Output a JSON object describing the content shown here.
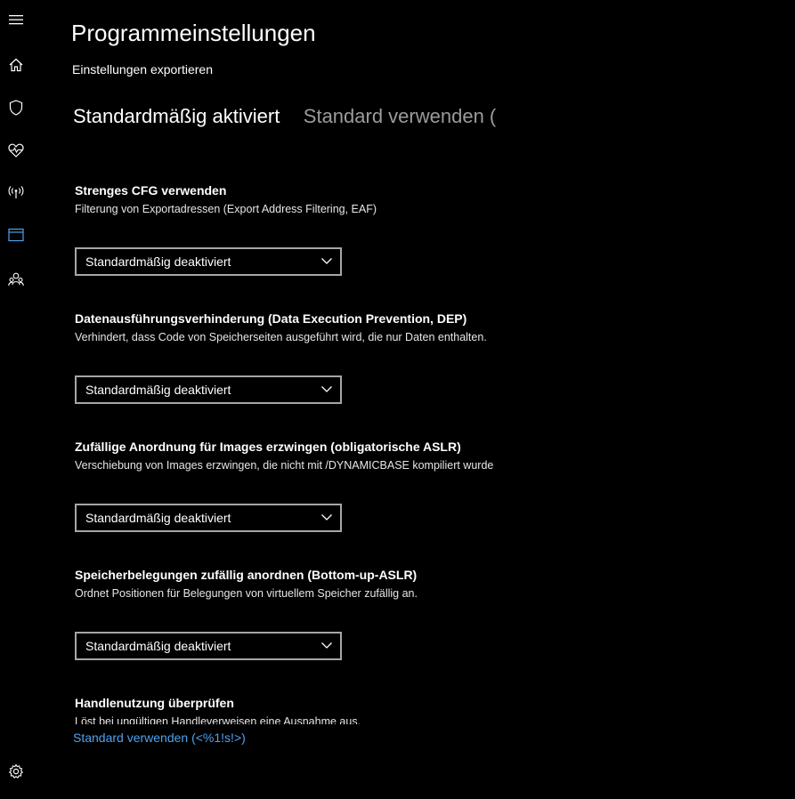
{
  "nav": {
    "items": [
      {
        "icon": "hamburger-menu-icon"
      },
      {
        "icon": "home-icon"
      },
      {
        "icon": "shield-icon"
      },
      {
        "icon": "heart-pulse-icon"
      },
      {
        "icon": "network-antenna-icon"
      },
      {
        "icon": "app-browser-icon",
        "active": true
      },
      {
        "icon": "family-icon"
      }
    ],
    "settings_icon": "gear-icon",
    "accent_color": "#4ea2ef"
  },
  "page": {
    "title": "Programmeinstellungen",
    "export_link": "Einstellungen exportieren"
  },
  "tabs": [
    {
      "label": "Standardmäßig aktiviert",
      "active": true
    },
    {
      "label": "Standard verwenden (",
      "active": false
    }
  ],
  "settings": [
    {
      "title": "Strenges CFG verwenden",
      "description": "Filterung von Exportadressen (Export Address Filtering, EAF)",
      "value": "Standardmäßig deaktiviert"
    },
    {
      "title": "Datenausführungsverhinderung (Data Execution Prevention, DEP)",
      "description": "Verhindert, dass Code von Speicherseiten ausgeführt wird, die nur Daten enthalten.",
      "value": "Standardmäßig deaktiviert"
    },
    {
      "title": "Zufällige Anordnung für Images erzwingen (obligatorische ASLR)",
      "description": "Verschiebung von Images erzwingen, die nicht mit /DYNAMICBASE kompiliert wurde",
      "value": "Standardmäßig deaktiviert"
    },
    {
      "title": "Speicherbelegungen zufällig anordnen (Bottom-up-ASLR)",
      "description": "Ordnet Positionen für Belegungen von virtuellem Speicher zufällig an.",
      "value": "Standardmäßig deaktiviert"
    },
    {
      "title": "Handlenutzung überprüfen",
      "description": "Löst bei ungültigen Handleverweisen eine Ausnahme aus."
    }
  ],
  "footer": {
    "link": "Standard verwenden (<%1!s!>)"
  }
}
